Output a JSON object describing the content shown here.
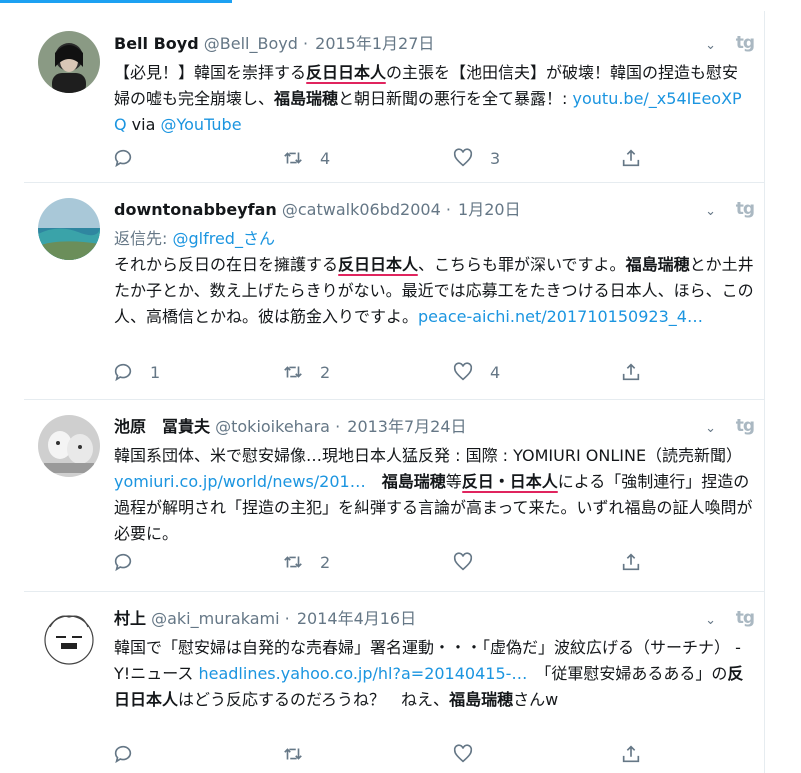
{
  "tweets": [
    {
      "name": "Bell Boyd",
      "handle": "@Bell_Boyd",
      "sep": "·",
      "time": "2015年1月27日",
      "text_parts": [
        "【必見！】韓国を崇拝する",
        "反日日本人",
        "の主張を【池田信夫】が破壊！韓国の捏造も慰安婦の嘘も完全崩壊し、",
        "福島瑞穂",
        "と朝日新聞の悪行を全て暴露！: ",
        "youtu.be/_x54IEeoXPQ",
        " via ",
        "@YouTube"
      ],
      "counts": {
        "reply": "",
        "retweet": "4",
        "like": "3"
      }
    },
    {
      "name": "downtonabbeyfan",
      "handle": "@catwalk06bd2004",
      "sep": "·",
      "time": "1月20日",
      "reply_label": "返信先: ",
      "reply_handle": "@glfred_さん",
      "text_parts": [
        "それから反日の在日を擁護する",
        "反日日本人",
        "、こちらも罪が深いですよ。",
        "福島瑞穂",
        "とか土井たか子とか、数え上げたらきりがない。最近では応募工をたきつける日本人、ほら、この人、高橋信とかね。彼は筋金入りですよ。",
        "peace-aichi.net/201710150923_4…"
      ],
      "counts": {
        "reply": "1",
        "retweet": "2",
        "like": "4"
      }
    },
    {
      "name": "池原　冨貴夫",
      "handle": "@tokioikehara",
      "sep": "·",
      "time": "2013年7月24日",
      "text_parts": [
        "韓国系団体、米で慰安婦像…現地日本人猛反発 : 国際 : YOMIURI ONLINE（読売新聞） ",
        "yomiuri.co.jp/world/news/201…",
        "　",
        "福島瑞穂",
        "等",
        "反日・日本人",
        "による「強制連行」捏造の過程が解明され「捏造の主犯」を糾弾する言論が高まって来た。いずれ福島の証人喚問が必要に。"
      ],
      "counts": {
        "reply": "",
        "retweet": "2",
        "like": ""
      }
    },
    {
      "name": "村上",
      "handle": "@aki_murakami",
      "sep": "·",
      "time": "2014年4月16日",
      "text_parts": [
        "韓国で「慰安婦は自発的な売春婦」署名運動・・・「虚偽だ」波紋広げる（サーチナ） - Y!ニュース ",
        "headlines.yahoo.co.jp/hl?a=20140415-…",
        "　「従軍慰安婦あるある」の",
        "反日日本人",
        "はどう反応するのだろうね？　ねえ、",
        "福島瑞穂",
        "さんw"
      ],
      "counts": {
        "reply": "",
        "retweet": "",
        "like": ""
      }
    }
  ]
}
